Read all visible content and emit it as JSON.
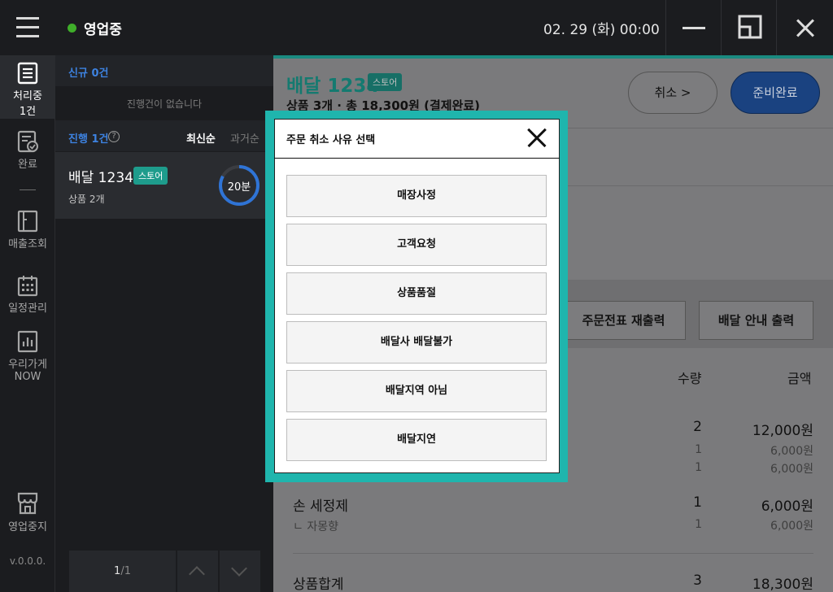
{
  "topbar": {
    "status": "영업중",
    "datetime": "02. 29 (화) 00:00"
  },
  "nav": {
    "items": [
      {
        "label": "처리중\n1건",
        "line1": "처리중",
        "line2": "1건"
      },
      {
        "label": "완료"
      },
      {
        "label": "매출조회"
      },
      {
        "label": "일정관리"
      },
      {
        "label": "우리가게",
        "line2": "NOW"
      },
      {
        "label": "영업중지"
      }
    ],
    "version": "v.0.0.0."
  },
  "orders": {
    "new_header": "신규 0건",
    "no_progress": "진행건이 없습니다",
    "progress_header": "진행 1건",
    "help": "?",
    "sort_new": "최신순",
    "sort_old": "과거순",
    "card": {
      "title": "배달 1234",
      "badge": "스토어",
      "sub": "상품 2개",
      "timer": "20분"
    },
    "pager": {
      "current": "1",
      "total": "/1"
    }
  },
  "detail": {
    "title": "배달 1234",
    "badge": "스토어",
    "summary": "상품 3개 · 총 18,300원 (결제완료)",
    "cancel_label": "취소 >",
    "ready_label": "준비완료",
    "reprint_label": "주문전표 재출력",
    "delivery_label": "배달 안내 출력",
    "col_qty": "수량",
    "col_amount": "금액",
    "items": [
      {
        "name": "",
        "qty": "2",
        "amount": "12,000원",
        "sub": [
          {
            "name": "",
            "qty": "1",
            "amount": "6,000원"
          },
          {
            "name": "",
            "qty": "1",
            "amount": "6,000원"
          }
        ]
      },
      {
        "name": "손 세정제",
        "qty": "1",
        "amount": "6,000원",
        "sub": [
          {
            "name": "ㄴ 자몽향",
            "qty": "1",
            "amount": "6,000원"
          }
        ]
      }
    ],
    "total_label": "상품합계",
    "total_qty": "3",
    "total_amount": "18,300원"
  },
  "modal": {
    "title": "주문 취소 사유 선택",
    "reasons": [
      "매장사정",
      "고객요청",
      "상품품절",
      "배달사 배달불가",
      "배달지역 아님",
      "배달지연"
    ]
  }
}
